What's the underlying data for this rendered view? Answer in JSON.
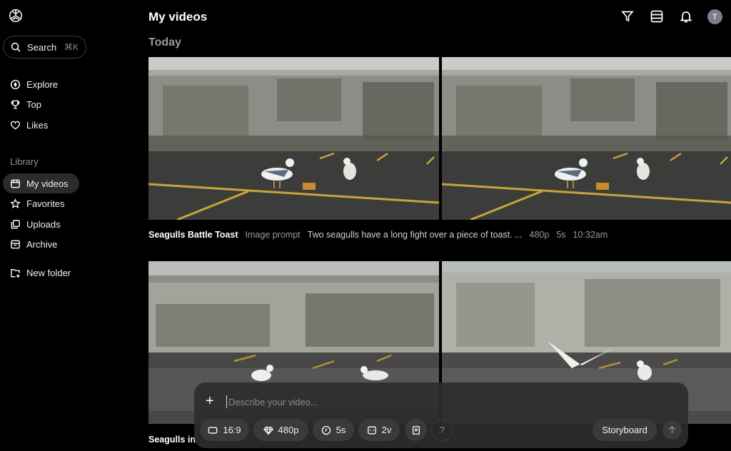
{
  "sidebar": {
    "search_label": "Search",
    "search_shortcut": "⌘K",
    "nav": [
      {
        "label": "Explore",
        "icon": "compass-icon"
      },
      {
        "label": "Top",
        "icon": "trophy-icon"
      },
      {
        "label": "Likes",
        "icon": "heart-icon"
      }
    ],
    "library_label": "Library",
    "library": [
      {
        "label": "My videos",
        "icon": "video-icon",
        "active": true
      },
      {
        "label": "Favorites",
        "icon": "star-icon"
      },
      {
        "label": "Uploads",
        "icon": "uploads-icon"
      },
      {
        "label": "Archive",
        "icon": "archive-icon"
      }
    ],
    "new_folder_label": "New folder"
  },
  "header": {
    "title": "My videos",
    "avatar_initial": "T"
  },
  "section": {
    "date_label": "Today"
  },
  "videos": [
    {
      "title": "Seagulls Battle Toast",
      "source": "Image prompt",
      "prompt": "Two seagulls have a long fight over a piece of toast. ...",
      "resolution": "480p",
      "duration": "5s",
      "time": "10:32am"
    },
    {
      "title": "Seagulls in"
    }
  ],
  "composer": {
    "placeholder": "Describe your video...",
    "aspect": "16:9",
    "resolution": "480p",
    "duration": "5s",
    "variations": "2v",
    "help": "?",
    "storyboard_label": "Storyboard"
  },
  "colors": {
    "background": "#000000",
    "chip": "#3a3a3a",
    "composer": "#2c2c2c",
    "active_nav": "#2b2b2b"
  }
}
